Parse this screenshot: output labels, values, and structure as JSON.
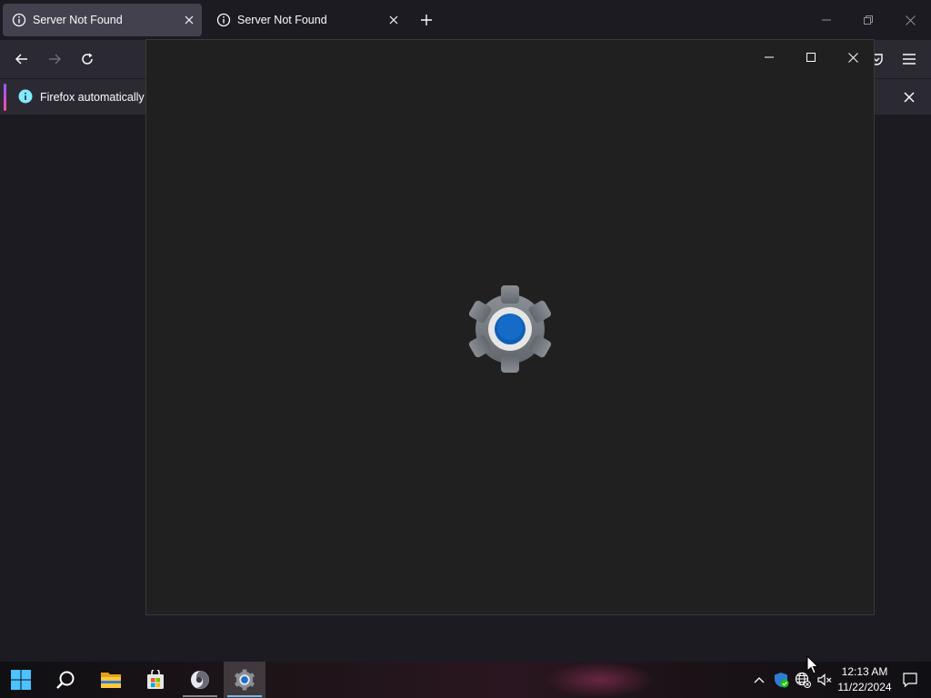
{
  "browser": {
    "tabs": [
      {
        "title": "Server Not Found",
        "selected": true
      },
      {
        "title": "Server Not Found",
        "selected": false
      }
    ],
    "notification": {
      "text": "Firefox automatically s"
    }
  },
  "taskbar": {
    "apps": [
      "start-icon",
      "search-icon",
      "file-explorer-icon",
      "microsoft-store-icon",
      "firefox-icon",
      "settings-icon"
    ],
    "clock": {
      "time": "12:13 AM",
      "date": "11/22/2024"
    }
  },
  "colors": {
    "accent": "#0067c0",
    "window_bg": "#202020",
    "browser_bg": "#1c1b22"
  }
}
